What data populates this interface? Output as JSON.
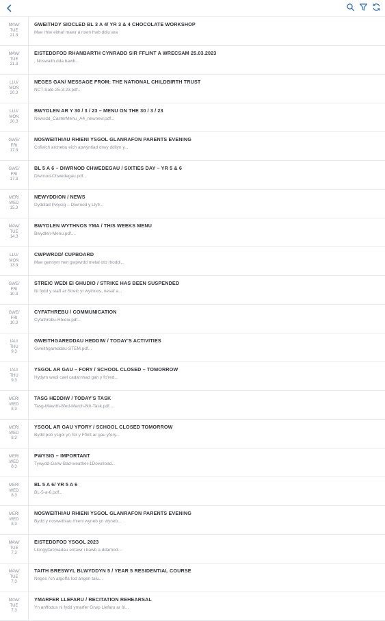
{
  "toolbar": {
    "back_icon": "chevron-left-icon",
    "actions": [
      "search-icon",
      "filter-icon",
      "refresh-icon"
    ],
    "accent": "#2f6fcf"
  },
  "messages": [
    {
      "day_cy": "MAW/",
      "day_en": "TUE",
      "date": "21.3",
      "title": "GWEITHDY SIOCLED BL 3 A 4/ YR 3 & 4 CHOCOLATE WORKSHOP",
      "snippet": "Mae rhiw eithaf mawr a rown hwb ddiu ara"
    },
    {
      "day_cy": "MAW/",
      "day_en": "TUE",
      "date": "21.3",
      "title": "EISTEDDFOD RHANBARTH CYNRADD SIR FFLINT A WRECSAM 25.03.2023",
      "snippet": ", Noswaith dda bawb..."
    },
    {
      "day_cy": "LLU/",
      "day_en": "MON",
      "date": "20.3",
      "title": "NEGES GAN/ MESSAGE FROM: THE NATIONAL CHILDBIRTH TRUST",
      "snippet": "NCT-Sale-25-3-23.pdf..."
    },
    {
      "day_cy": "LLU/",
      "day_en": "MON",
      "date": "20.3",
      "title": "BWYDLEN AR Y 30 / 3 / 23 – MENU ON THE 30 / 3 / 23",
      "snippet": "Newsdd_CasterMenu_A4_newnew.pdf..."
    },
    {
      "day_cy": "GWE/",
      "day_en": "FRI",
      "date": "17.3",
      "title": "NOSWEITHIAU RHIENI YSGOL GLANRAFON PARENTS EVENING",
      "snippet": "Cofiwch archebu eich apwyntiad drwy ddilyn y..."
    },
    {
      "day_cy": "GWE/",
      "day_en": "FRI",
      "date": "17.3",
      "title": "BL 5 A 6 – DIWRNOD CHWEDEGAU / SIXTIES DAY – YR 5 & 6",
      "snippet": "Diwrnod-Chwedegau.pdf..."
    },
    {
      "day_cy": "MER/",
      "day_en": "WED",
      "date": "15.3",
      "title": "NEWYDDION / NEWS",
      "snippet": "Dyddiad Pwysig – Diwrnod y Llyfr..."
    },
    {
      "day_cy": "MAW/",
      "day_en": "TUE",
      "date": "14.3",
      "title": "BWYDLEN WYTHNOS YMA / THIS WEEKS MENU",
      "snippet": "Bwydlen-Menu.pdf..."
    },
    {
      "day_cy": "LLU/",
      "day_en": "MON",
      "date": "13.3",
      "title": "CWPWRDD/ CUPBOARD",
      "snippet": "Mae gennym hen gwpwrdd metal oto rhoddi..."
    },
    {
      "day_cy": "GWE/",
      "day_en": "FRI",
      "date": "10.3",
      "title": "STREIC WEDI EI GHUDIO / STRIKE HAS BEEN SUSPENDED",
      "snippet": "Ni fydd y staff ar Streic yr wythnos, nesaf a..."
    },
    {
      "day_cy": "GWE/",
      "day_en": "FRI",
      "date": "10.3",
      "title": "CYFATHREBU / COMMUNICATION",
      "snippet": "Cyfathrebu-Rhieni.pdf..."
    },
    {
      "day_cy": "IAU/",
      "day_en": "THU",
      "date": "9.3",
      "title": "GWEITHGAREDDAU HEDDIW / TODAY'S ACTIVITIES",
      "snippet": "Gweithgareddau-STEM.pdf..."
    },
    {
      "day_cy": "IAU/",
      "day_en": "THU",
      "date": "9.3",
      "title": "YSGOL AR GAU – FORY / SCHOOL CLOSED – TOMORROW",
      "snippet": "Hydym wedi cael cadarnhad gan y fo'red..."
    },
    {
      "day_cy": "MER/",
      "day_en": "WED",
      "date": "8.3",
      "title": "TASG HEDDIW / TODAY'S TASK",
      "snippet": "Tasg-Mawrth-8fed-March-8th-Task.pdf..."
    },
    {
      "day_cy": "MER/",
      "day_en": "WED",
      "date": "8.3",
      "title": "YSGOL AR GAU YFORY / SCHOOL CLOSED TOMORROW",
      "snippet": "Bydd pob ysgol yn Sir y Fflint ar gau yfory..."
    },
    {
      "day_cy": "MER/",
      "day_en": "WED",
      "date": "8.3",
      "title": "PWYSIG – IMPORTANT",
      "snippet": "Tywydd-Garw-Bad-weather-1Download..."
    },
    {
      "day_cy": "MER/",
      "day_en": "WED",
      "date": "8.3",
      "title": "BL 5 A 6/ YR 5 A 6",
      "snippet": "BL-5-a-6.pdf..."
    },
    {
      "day_cy": "MER/",
      "day_en": "WED",
      "date": "8.3",
      "title": "NOSWEITHIAU RHIENI YSGOL GLANRAFON PARENTS EVENING",
      "snippet": "Bydd y noswethiau rhieni wyneb yn wyneb..."
    },
    {
      "day_cy": "MAW/",
      "day_en": "TUE",
      "date": "7.3",
      "title": "EISTEDDFOD YSGOL 2023",
      "snippet": "Llongyfarchiadau enfawr i bawb a ddarnod..."
    },
    {
      "day_cy": "MAW/",
      "day_en": "TUE",
      "date": "7.3",
      "title": "TAITH BRESWYL BLWYDDYN 5 / YEAR 5 RESIDENTIAL COURSE",
      "snippet": "Neges i'ch atgoffa fod angen talu..."
    },
    {
      "day_cy": "MAW/",
      "day_en": "TUE",
      "date": "7.3",
      "title": "YMARFER LLEFARU / RECITATION REHEARSAL",
      "snippet": "Yn anffodus ni fydd ymarfer Grwp Llefaru ar ôl..."
    }
  ]
}
